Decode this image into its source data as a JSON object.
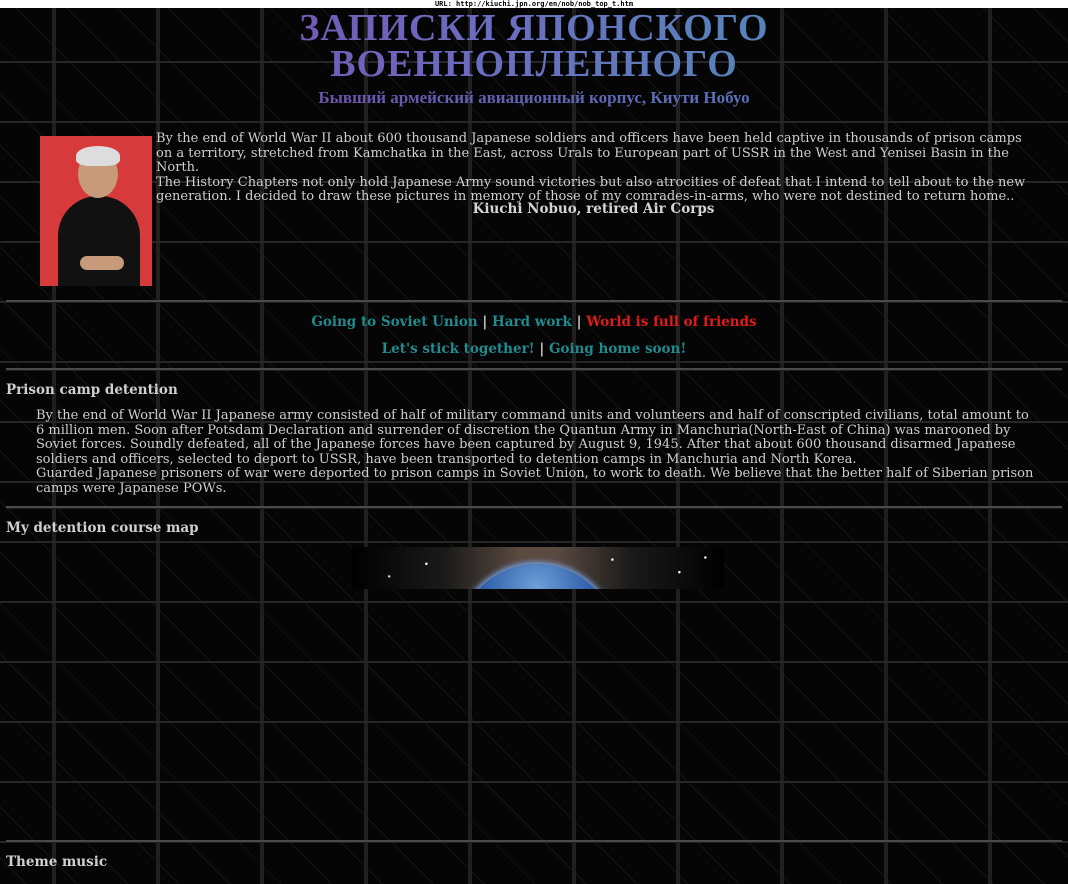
{
  "url_bar": {
    "text": "URL: http://kiuchi.jpn.org/en/nob/nob_top_t.htm"
  },
  "header": {
    "title_line1": "ЗАПИСКИ ЯПОНСКОГО",
    "title_line2": "ВОЕННОПЛЕННОГО",
    "subtitle": "Бывший армейский авиационный корпус, Киути Нобуо"
  },
  "intro": {
    "paragraph1": "By the end of World War II about 600 thousand Japanese soldiers and officers have been held captive in thousands of prison camps on a territory, stretched from Kamchatka in the East, across Urals to European part of USSR in the West and Yenisei Basin in the North.",
    "paragraph2": "The History Chapters not only hold Japanese Army sound victories but also atrocities of defeat that I intend to tell about to the new generation. I decided to draw these pictures in memory of those of my comrades-in-arms, who were not destined to return home..",
    "signature": "Kiuchi Nobuo, retired Air Corps"
  },
  "nav": {
    "row1": [
      {
        "label": "Going to Soviet Union",
        "color": "#1f8b8f"
      },
      {
        "label": "Hard work",
        "color": "#1f8b8f"
      },
      {
        "label": "World is full of friends",
        "color": "#e01b1b"
      }
    ],
    "row2": [
      {
        "label": "Let's stick together!",
        "color": "#1f8b8f"
      },
      {
        "label": "Going home soon!",
        "color": "#1f8b8f"
      }
    ],
    "separator": "|"
  },
  "sections": {
    "detention": {
      "title": "Prison camp detention",
      "paragraph1": "By the end of World War II Japanese army consisted of half of military command units and volunteers and half of conscripted civilians, total amount to 6 million men. Soon after Potsdam Declaration and surrender of discretion the Quantun Army in Manchuria(North-East of China) was marooned by Soviet forces. Soundly defeated, all of the Japanese forces have been captured by August 9, 1945. After that about 600 thousand disarmed Japanese soldiers and officers, selected to deport to USSR, have been transported to detention camps in Manchuria and North Korea.",
      "paragraph2": "Guarded Japanese prisoners of war were deported to prison camps in Soviet Union, to work to death. We believe that the better half of Siberian prison camps were Japanese POWs."
    },
    "map": {
      "title": "My detention course map"
    },
    "music": {
      "title": "Theme music"
    }
  },
  "colors": {
    "background": "#050505",
    "text": "#cfcfcf",
    "link": "#1f8b8f",
    "link_active": "#e01b1b"
  }
}
